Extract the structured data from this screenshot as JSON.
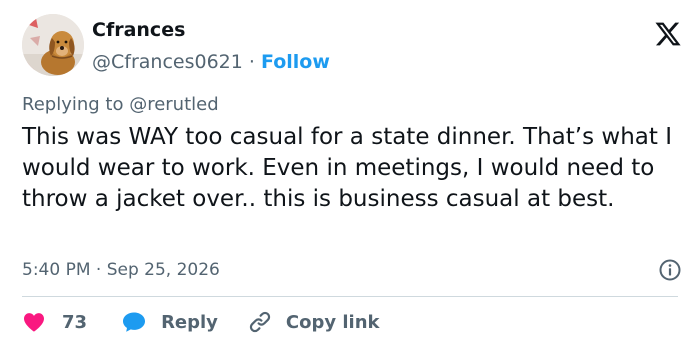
{
  "author": {
    "display_name": "Cfrances",
    "handle": "@Cfrances0621",
    "separator": "·",
    "follow_label": "Follow"
  },
  "reply_context": {
    "prefix": "Replying to ",
    "mention": "@rerutled"
  },
  "tweet": {
    "text": "This was WAY too casual for a state dinner. That’s what I would wear to work. Even in meetings, I would need to throw a jacket over.. this is business casual at best.",
    "timestamp": "5:40 PM · Sep 25, 2026"
  },
  "actions": {
    "like_count": "73",
    "reply_label": "Reply",
    "copy_link_label": "Copy link"
  },
  "colors": {
    "accent": "#1d9bf0",
    "like": "#f91880",
    "secondary_text": "#536471",
    "primary_text": "#0f1419",
    "divider": "#cfd9de"
  },
  "icons": {
    "brand": "x-logo-icon",
    "info": "info-icon",
    "like": "heart-icon",
    "reply": "speech-bubble-icon",
    "copy": "link-icon"
  }
}
